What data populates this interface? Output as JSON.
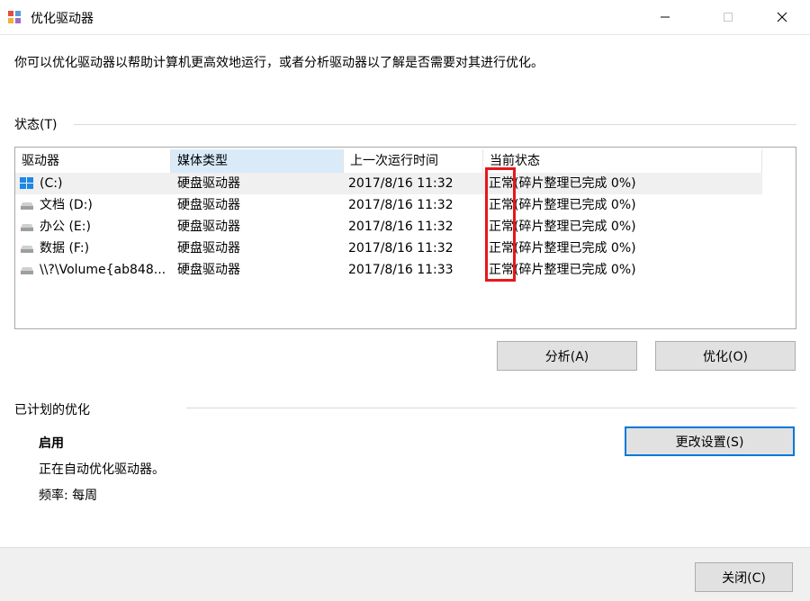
{
  "window": {
    "title": "优化驱动器",
    "minimize_icon": "minimize-icon",
    "maximize_icon": "maximize-icon",
    "close_icon": "close-icon"
  },
  "description": "你可以优化驱动器以帮助计算机更高效地运行，或者分析驱动器以了解是否需要对其进行优化。",
  "status": {
    "label": "状态(T)",
    "columns": [
      "驱动器",
      "媒体类型",
      "上一次运行时间",
      "当前状态"
    ],
    "rows": [
      {
        "drive": "(C:)",
        "media": "硬盘驱动器",
        "last_run": "2017/8/16 11:32",
        "status": "正常(碎片整理已完成 0%)",
        "icon": "windows-drive-icon"
      },
      {
        "drive": "文档 (D:)",
        "media": "硬盘驱动器",
        "last_run": "2017/8/16 11:32",
        "status": "正常(碎片整理已完成 0%)",
        "icon": "hard-drive-icon"
      },
      {
        "drive": "办公 (E:)",
        "media": "硬盘驱动器",
        "last_run": "2017/8/16 11:32",
        "status": "正常(碎片整理已完成 0%)",
        "icon": "hard-drive-icon"
      },
      {
        "drive": "数据 (F:)",
        "media": "硬盘驱动器",
        "last_run": "2017/8/16 11:32",
        "status": "正常(碎片整理已完成 0%)",
        "icon": "hard-drive-icon"
      },
      {
        "drive": "\\\\?\\Volume{ab848...",
        "media": "硬盘驱动器",
        "last_run": "2017/8/16 11:33",
        "status": "正常(碎片整理已完成 0%)",
        "icon": "hard-drive-icon"
      }
    ],
    "analyze_label": "分析(A)",
    "optimize_label": "优化(O)"
  },
  "scheduled": {
    "label": "已计划的优化",
    "state": "启用",
    "message": "正在自动优化驱动器。",
    "frequency": "频率: 每周",
    "change_settings_label": "更改设置(S)"
  },
  "footer": {
    "close_label": "关闭(C)"
  },
  "colors": {
    "accent": "#0078d7",
    "highlight_box": "#e8161b",
    "selected_header": "#d9ebf9"
  }
}
